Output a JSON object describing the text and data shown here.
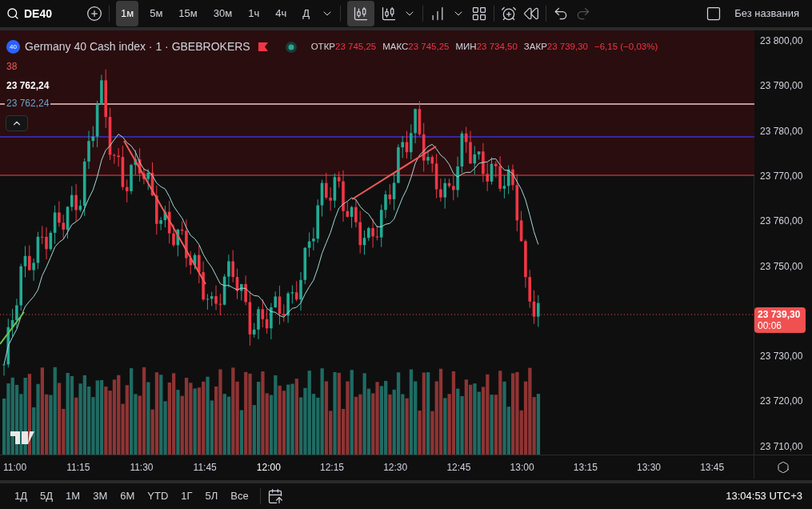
{
  "toolbar": {
    "symbol": "DE40",
    "intervals": [
      {
        "label": "1м",
        "selected": true
      },
      {
        "label": "5м",
        "selected": false
      },
      {
        "label": "15м",
        "selected": false
      },
      {
        "label": "30м",
        "selected": false
      },
      {
        "label": "1ч",
        "selected": false
      },
      {
        "label": "4ч",
        "selected": false
      },
      {
        "label": "Д",
        "selected": false
      }
    ],
    "layout_name": "Без названия"
  },
  "legend": {
    "badge": "40",
    "title": "Germany 40 Cash index · 1 · GBEBROKERS",
    "ohlc": [
      {
        "label": "ОТКР",
        "value": "23 745,25"
      },
      {
        "label": "МАКС",
        "value": "23 745,25"
      },
      {
        "label": "МИН",
        "value": "23 734,50"
      },
      {
        "label": "ЗАКР",
        "value": "23 739,30"
      }
    ],
    "change": "−6,15 (−0,03%)"
  },
  "overlay_labels": {
    "indicator_value": "38",
    "price_label": "23 762,24",
    "average_label": "23 762,24"
  },
  "price_axis": {
    "ticks": [
      "23 800,00",
      "23 790,00",
      "23 780,00",
      "23 770,00",
      "23 760,00",
      "23 750,00",
      "23 730,00",
      "23 720,00",
      "23 710,00"
    ],
    "last_price": "23 739,30",
    "countdown": "00:06"
  },
  "time_axis": {
    "ticks": [
      "11:00",
      "11:15",
      "11:30",
      "11:45",
      "12:00",
      "12:15",
      "12:30",
      "12:45",
      "13:00",
      "13:15",
      "13:30",
      "13:45"
    ]
  },
  "bottom_bar": {
    "ranges": [
      "1Д",
      "5Д",
      "1М",
      "3М",
      "6М",
      "YTD",
      "1Г",
      "5Л",
      "Все"
    ],
    "clock": "13:04:53 UTC+3"
  }
}
